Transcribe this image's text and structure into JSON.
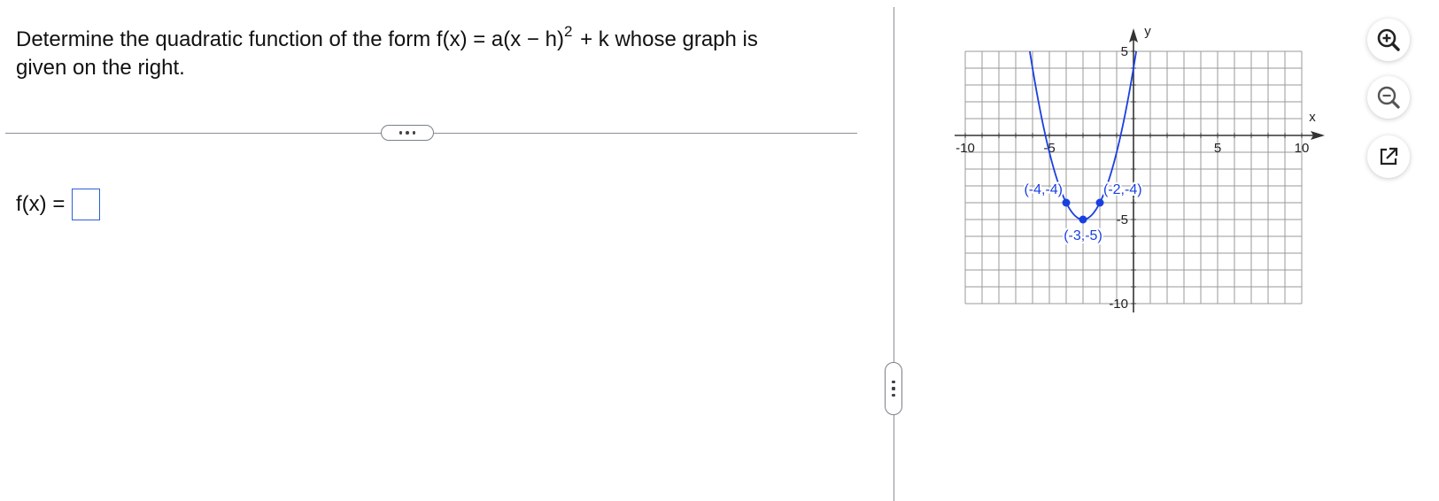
{
  "question": {
    "text_before_exponent": "Determine the quadratic function of the form f(x) = a(x − h)",
    "exponent": "2",
    "text_after_exponent": " + k whose graph is given on the right."
  },
  "answer": {
    "label": "f(x) =",
    "value": ""
  },
  "graph": {
    "x_axis_label": "x",
    "y_axis_label": "y",
    "x_range": [
      -10,
      10
    ],
    "y_range": [
      -10,
      5
    ],
    "labeled_ticks": {
      "x": [
        {
          "value": -10,
          "label": "-10"
        },
        {
          "value": -5,
          "label": "-5"
        },
        {
          "value": 5,
          "label": "5"
        },
        {
          "value": 10,
          "label": "10"
        }
      ],
      "y": [
        {
          "value": 5,
          "label": "5"
        },
        {
          "value": -5,
          "label": "-5"
        },
        {
          "value": -10,
          "label": "-10"
        }
      ]
    },
    "curve": {
      "type": "parabola",
      "a": 1,
      "h": -3,
      "k": -5
    },
    "points": [
      {
        "x": -4,
        "y": -4,
        "label": "(-4,-4)",
        "label_side": "left"
      },
      {
        "x": -2,
        "y": -4,
        "label": "(-2,-4)",
        "label_side": "right"
      },
      {
        "x": -3,
        "y": -5,
        "label": "(-3,-5)",
        "label_side": "below"
      }
    ],
    "grid": true,
    "colors": {
      "curve": "#1a3fe0",
      "grid": "#9a9a9a",
      "axis": "#333333",
      "label": "#1a3fe0"
    }
  },
  "tools": [
    {
      "name": "zoom-in",
      "icon": "zoom-in-icon"
    },
    {
      "name": "zoom-out",
      "icon": "zoom-out-icon"
    },
    {
      "name": "open-in-new-window",
      "icon": "external-link-icon"
    }
  ]
}
